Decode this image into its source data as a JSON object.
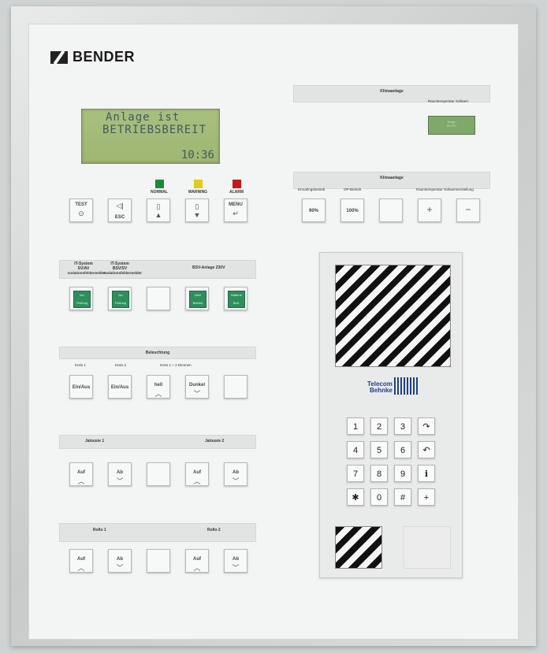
{
  "brand": "BENDER",
  "lcd": {
    "line1": "Anlage ist",
    "line2": "BETRIEBSBEREIT",
    "time": "10:36"
  },
  "leds": [
    {
      "label": "NORMAL",
      "color": "#1a8a3a"
    },
    {
      "label": "WARNING",
      "color": "#e1cc1b"
    },
    {
      "label": "ALARM",
      "color": "#c8191a"
    }
  ],
  "keys": {
    "test": "TEST",
    "esc": "ESC",
    "menu": "MENU"
  },
  "clima1": {
    "title": "Klimaanlage",
    "sub": "Raumtemperatur Sollwert",
    "lcd_line1": "Temp.",
    "lcd_line2": "22,0°C"
  },
  "clima2": {
    "title": "Klimaanlage",
    "lab1": "Ermahngsbetrieb",
    "lab2": "OP-Betrieb",
    "lab3": "Raumtemperatur Sollwertverstellung",
    "key1": "90%",
    "key2": "100%"
  },
  "itsystem": {
    "lab1": "IT-System",
    "lab1b": "SV/AV",
    "lab1c": "Isolationsfehlermelder",
    "lab2": "IT-System",
    "lab2b": "BSV/SV",
    "lab2c": "Isolationsfehlermelder",
    "title": "BSV-Anlage 230V",
    "g1a": "Iso",
    "g1b": "Prüfung",
    "g2a": "Iso",
    "g2b": "Prüfung",
    "g3a": "Netz",
    "g3b": "Betrieb",
    "g4a": "Batterie",
    "g4b": "Betr."
  },
  "licht": {
    "title": "Beleuchtung",
    "k1": "Kreis 1",
    "k2": "Kreis 2",
    "k3": "Kreis 1 + 2 Dimmen",
    "b1": "Ein/Aus",
    "b2": "Ein/Aus",
    "b3": "hell",
    "b4": "Dunkel"
  },
  "jal": {
    "t1": "Jalousie 1",
    "t2": "Jalousie 2",
    "b1": "Auf",
    "b2": "Ab",
    "b3": "Auf",
    "b4": "Ab"
  },
  "rollo": {
    "t1": "Rollo 1",
    "t2": "Rollo 2",
    "b1": "Auf",
    "b2": "Ab",
    "b3": "Auf",
    "b4": "Ab"
  },
  "telecom": {
    "line1": "Telecom",
    "line2": "Behnke"
  },
  "keypad": [
    "1",
    "2",
    "3",
    "↷",
    "4",
    "5",
    "6",
    "↶",
    "7",
    "8",
    "9",
    "ℹ",
    "✱",
    "0",
    "#",
    "+"
  ]
}
